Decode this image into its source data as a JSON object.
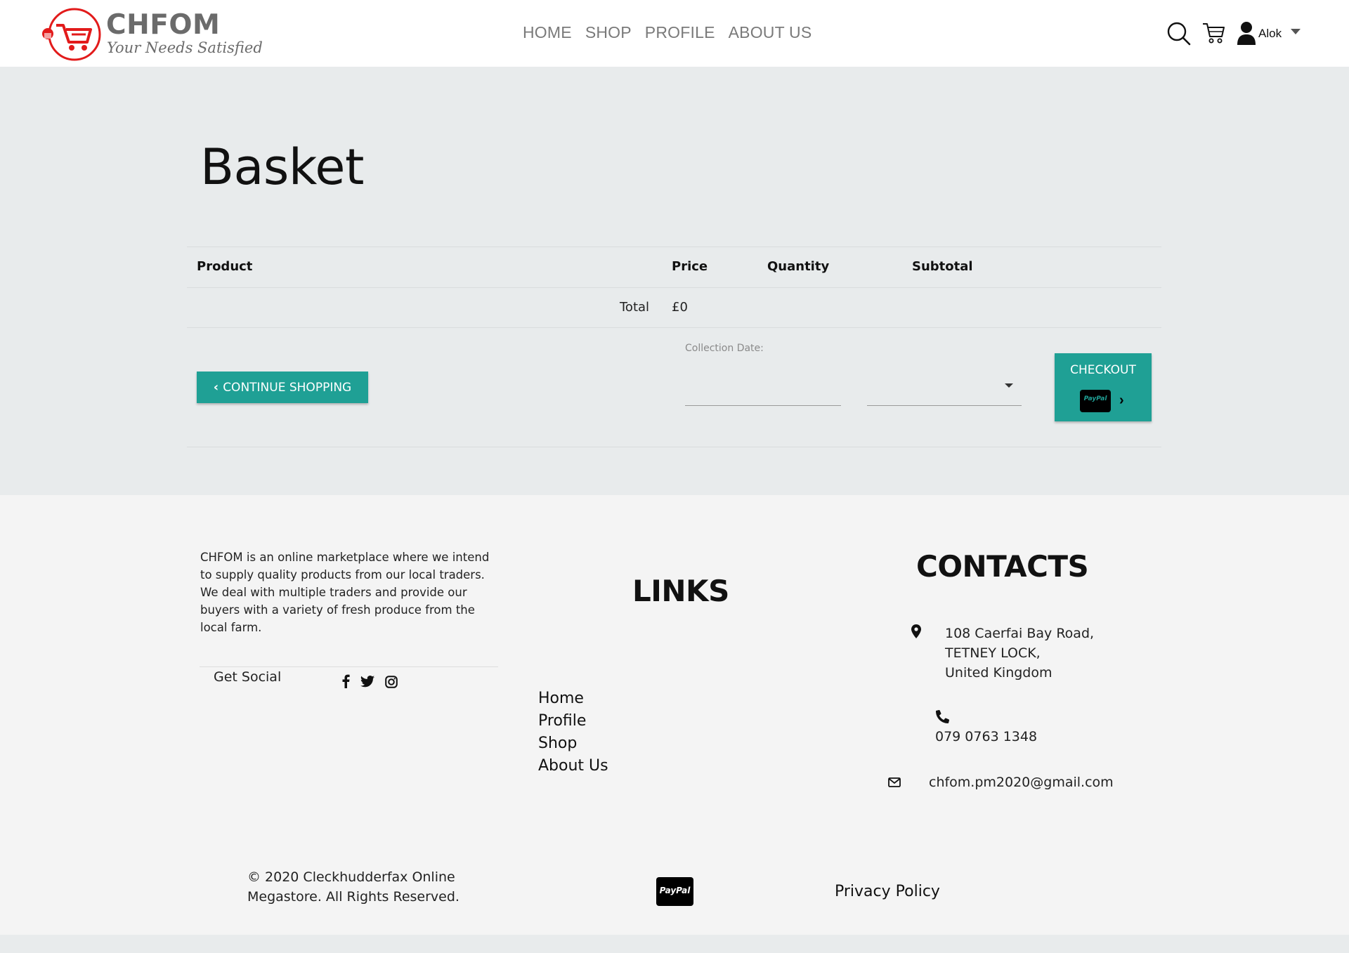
{
  "header": {
    "brand": "CHFOM",
    "tagline": "Your Needs Satisfied",
    "nav": [
      "HOME",
      "SHOP",
      "PROFILE",
      "ABOUT US"
    ],
    "user_name": "Alok",
    "icons": [
      "search-icon",
      "cart-icon",
      "user-icon",
      "caret-down-icon"
    ]
  },
  "basket": {
    "title": "Basket",
    "columns": [
      "Product",
      "Price",
      "Quantity",
      "Subtotal"
    ],
    "total_label": "Total",
    "total_value": "£0",
    "continue_label": "CONTINUE SHOPPING",
    "collection_label": "Collection Date:",
    "date_value": "",
    "time_value": "",
    "checkout_label": "CHECKOUT",
    "paypal_mark": "PayPal"
  },
  "footer": {
    "about_text": "CHFOM is an online marketplace where we intend to supply quality products from our local traders. We deal with multiple traders and provide our buyers with a variety of fresh produce from the local farm.",
    "get_social": "Get Social",
    "links_title": "LINKS",
    "links": [
      "Home",
      "Profile",
      "Shop",
      "About Us"
    ],
    "contacts_title": "CONTACTS",
    "address": [
      "108 Caerfai Bay Road,",
      "TETNEY LOCK,",
      "United Kingdom"
    ],
    "phone": "079 0763 1348",
    "email": "chfom.pm2020@gmail.com",
    "copyright": "© 2020 Cleckhudderfax Online Megastore. All Rights Reserved.",
    "paypal": "PayPal",
    "privacy": "Privacy Policy"
  },
  "colors": {
    "accent": "#1fa095",
    "brand_red": "#e21b1b",
    "main_bg": "#e8ebec",
    "footer_bg": "#f4f4f4"
  }
}
